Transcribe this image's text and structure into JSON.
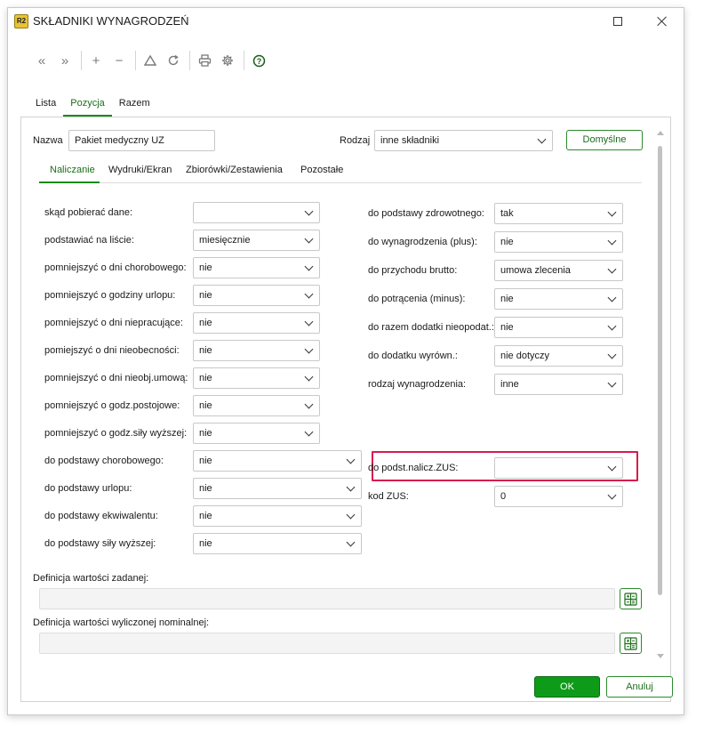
{
  "window": {
    "title": "SKŁADNIKI WYNAGRODZEŃ",
    "app_icon_text": "R2"
  },
  "toolbar": {
    "icons": [
      "double-chevron-left-icon",
      "double-chevron-right-icon",
      "plus-icon",
      "minus-icon",
      "triangle-icon",
      "refresh-icon",
      "print-icon",
      "gear-icon",
      "help-icon"
    ],
    "glyphs": {
      "first": "«",
      "last": "»",
      "add": "+",
      "remove": "−",
      "help": "?"
    }
  },
  "main_tabs": [
    "Lista",
    "Pozycja",
    "Razem"
  ],
  "main_tab_active": "Pozycja",
  "header": {
    "name_label": "Nazwa",
    "name_value": "Pakiet medyczny UZ",
    "type_label": "Rodzaj",
    "type_value": "inne składniki",
    "default_button": "Domyślne"
  },
  "subtabs": [
    "Naliczanie",
    "Wydruki/Ekran",
    "Zbiorówki/Zestawienia",
    "Pozostałe"
  ],
  "subtab_active": "Naliczanie",
  "left_fields": [
    {
      "label": "skąd pobierać dane:",
      "value": ""
    },
    {
      "label": "podstawiać na liście:",
      "value": "miesięcznie"
    },
    {
      "label": "pomniejszyć o dni chorobowego:",
      "value": "nie"
    },
    {
      "label": "pomniejszyć o godziny urlopu:",
      "value": "nie"
    },
    {
      "label": "pomniejszyć o dni niepracujące:",
      "value": "nie"
    },
    {
      "label": "pomiejszyć o dni nieobecności:",
      "value": "nie"
    },
    {
      "label": "pomniejszyć o dni nieobj.umową:",
      "value": "nie"
    },
    {
      "label": "pomniejszyć o godz.postojowe:",
      "value": "nie"
    },
    {
      "label": "pomniejszyć o godz.siły wyższej:",
      "value": "nie"
    },
    {
      "label": "do podstawy chorobowego:",
      "value": "nie"
    },
    {
      "label": "do podstawy urlopu:",
      "value": "nie"
    },
    {
      "label": "do podstawy ekwiwalentu:",
      "value": "nie"
    },
    {
      "label": "do podstawy siły wyższej:",
      "value": "nie"
    }
  ],
  "right_fields": [
    {
      "label": "do podstawy zdrowotnego:",
      "value": "tak"
    },
    {
      "label": "do wynagrodzenia (plus):",
      "value": "nie"
    },
    {
      "label": "do przychodu brutto:",
      "value": "umowa zlecenia"
    },
    {
      "label": "do potrącenia (minus):",
      "value": "nie"
    },
    {
      "label": "do razem dodatki nieopodat.:",
      "value": "nie"
    },
    {
      "label": "do dodatku wyrówn.:",
      "value": "nie dotyczy"
    },
    {
      "label": "rodzaj wynagrodzenia:",
      "value": "inne"
    }
  ],
  "zus_fields": [
    {
      "label": "do podst.nalicz.ZUS:",
      "value": ""
    },
    {
      "label": "kod ZUS:",
      "value": "0"
    }
  ],
  "definitions": {
    "set_value_label": "Definicja wartości zadanej:",
    "computed_label": "Definicja wartości wyliczonej nominalnej:"
  },
  "buttons": {
    "ok": "OK",
    "cancel": "Anuluj"
  },
  "colors": {
    "accent": "#1a8a1a",
    "ok_bg": "#0f9b1a",
    "highlight": "#d81b4f"
  }
}
